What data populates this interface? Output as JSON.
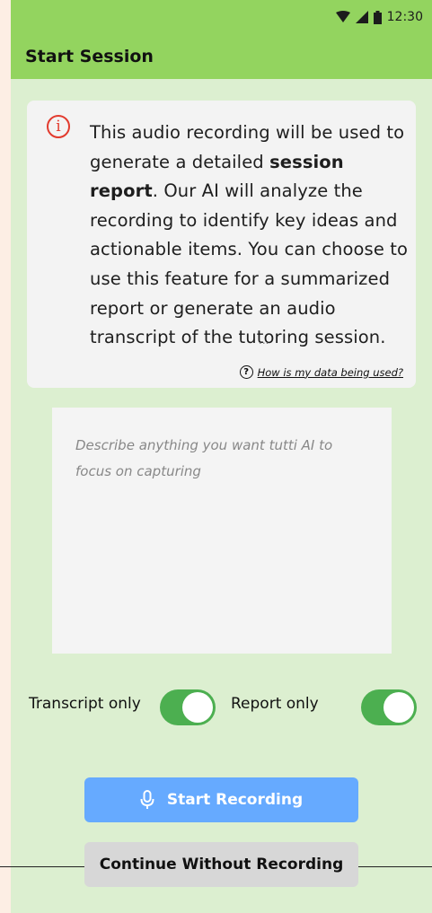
{
  "status_bar": {
    "time": "12:30",
    "icons": [
      "wifi-icon",
      "signal-icon",
      "battery-icon"
    ]
  },
  "app_bar": {
    "title": "Start Session"
  },
  "info_card": {
    "icon": "info-icon",
    "text_1": "This audio recording will be used to generate a detailed ",
    "bold": "session report",
    "text_2": ". Our AI will analyze the recording to identify key ideas and actionable items. You can choose to use this feature for a summarized report or generate an audio transcript of the tutoring session.",
    "more": "...",
    "data_link": "How is my data being used?"
  },
  "notes": {
    "value": "",
    "placeholder": "Describe anything you want tutti AI to focus on capturing"
  },
  "toggles": [
    {
      "label": "Transcript only",
      "on": true
    },
    {
      "label": "Report only",
      "on": true
    }
  ],
  "buttons": {
    "start_recording": "Start Recording",
    "continue_without": "Continue Without Recording"
  },
  "colors": {
    "appbar": "#93d45f",
    "background": "#dcefd0",
    "accent_toggle": "#4caf50",
    "primary_button": "#66aaff",
    "info_icon": "#e23b2e"
  }
}
